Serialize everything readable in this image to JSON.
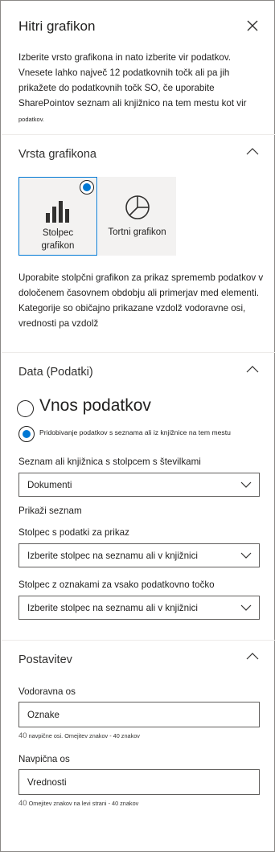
{
  "panel": {
    "title": "Hitri grafikon",
    "intro_main": "Izberite vrsto grafikona in nato izberite vir podatkov. Vnesete lahko največ 12 podatkovnih točk ali pa jih prikažete do podatkovnih točk SO, če uporabite SharePointov seznam ali knjižnico na tem mestu kot vir",
    "intro_tail": "podatkov."
  },
  "chart_type_section": {
    "title": "Vrsta grafikona",
    "column_tile": {
      "label_line1": "Stolpec",
      "label_line2": "grafikon",
      "icon": "column-chart-icon",
      "selected": true
    },
    "pie_tile": {
      "label": "Tortni grafikon",
      "icon": "pie-chart-icon",
      "selected": false
    },
    "description": "Uporabite stolpčni grafikon za prikaz sprememb podatkov v določenem časovnem obdobju ali primerjav med elementi. Kategorije so običajno prikazane vzdolž vodoravne osi, vrednosti pa vzdolž"
  },
  "data_section": {
    "title": "Data (Podatki)",
    "option_enter": "Vnos podatkov",
    "option_list": "Pridobivanje podatkov s seznama ali iz knjižnice na tem mestu",
    "list_label": "Seznam ali knjižnica s stolpcem s številkami",
    "list_value": "Dokumenti",
    "show_list_link": "Prikaži seznam",
    "data_column_label": "Stolpec s podatki za prikaz",
    "data_column_value": "Izberite stolpec na seznamu ali v knjižnici",
    "label_column_label": "Stolpec z oznakami za vsako podatkovno točko",
    "label_column_value": "Izberite stolpec na seznamu ali v knjižnici"
  },
  "layout_section": {
    "title": "Postavitev",
    "horizontal_axis_label": "Vodoravna os",
    "horizontal_axis_value": "Oznake",
    "horizontal_helper_count": "40",
    "horizontal_helper_text": "navpične osi. Omejitev znakov - 40 znakov",
    "vertical_axis_label": "Navpična os",
    "vertical_axis_value": "Vrednosti",
    "vertical_helper_count": "40",
    "vertical_helper_text": "Omejitev znakov na levi strani - 40 znakov"
  },
  "colors": {
    "accent": "#0078d4",
    "border": "#605e5c",
    "tile_bg": "#f3f2f1",
    "divider": "#edebe9"
  }
}
